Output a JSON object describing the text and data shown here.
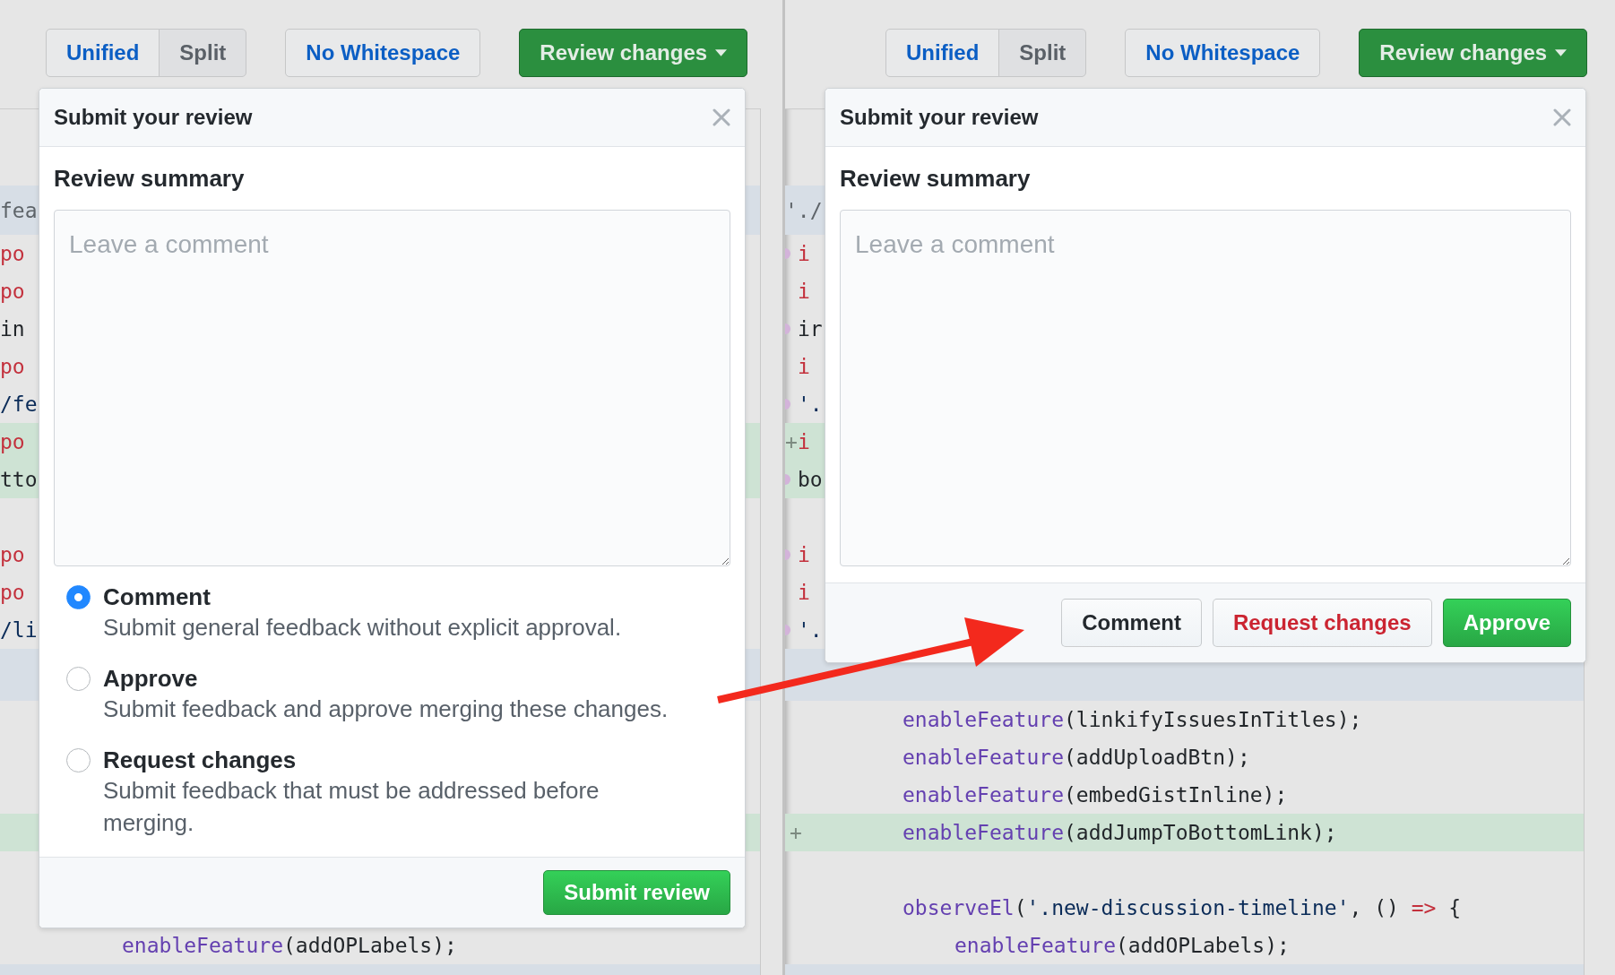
{
  "panels": [
    {
      "toolbar": {
        "view_tabs": [
          {
            "label": "Unified",
            "selected": false
          },
          {
            "label": "Split",
            "selected": true
          }
        ],
        "whitespace_button": "No Whitespace",
        "review_button": "Review changes"
      },
      "diff": {
        "upper_rows": [
          {
            "kind": "hunk",
            "tokens": [
              {
                "text": "fea",
                "kind": "comment"
              }
            ]
          },
          {
            "kind": "context",
            "tokens": [
              {
                "text": "po",
                "kind": "keyword"
              }
            ]
          },
          {
            "kind": "context",
            "tokens": [
              {
                "text": "po",
                "kind": "keyword"
              }
            ]
          },
          {
            "kind": "context",
            "tokens": [
              {
                "text": "in",
                "kind": "plain"
              }
            ]
          },
          {
            "kind": "context",
            "tokens": [
              {
                "text": "po",
                "kind": "keyword"
              }
            ]
          },
          {
            "kind": "context",
            "tokens": [
              {
                "text": "/fe",
                "kind": "string"
              }
            ]
          },
          {
            "kind": "added",
            "tokens": [
              {
                "text": "po",
                "kind": "keyword"
              }
            ]
          },
          {
            "kind": "added",
            "tokens": [
              {
                "text": "tto",
                "kind": "plain"
              }
            ]
          },
          {
            "kind": "context"
          },
          {
            "kind": "context",
            "tokens": [
              {
                "text": "po",
                "kind": "keyword"
              }
            ]
          },
          {
            "kind": "context",
            "tokens": [
              {
                "text": "po",
                "kind": "keyword"
              }
            ]
          },
          {
            "kind": "context",
            "tokens": [
              {
                "text": "/li",
                "kind": "string"
              }
            ]
          }
        ],
        "lower_rows": [
          {
            "kind": "hunk"
          },
          {
            "kind": "context"
          },
          {
            "kind": "context"
          },
          {
            "kind": "context"
          },
          {
            "kind": "added"
          },
          {
            "kind": "context"
          },
          {
            "kind": "context"
          },
          {
            "kind": "context",
            "indented": true,
            "tokens": [
              {
                "text": "enableFeature",
                "kind": "function"
              },
              {
                "text": "(addOPLabels);",
                "kind": "plain"
              }
            ]
          },
          {
            "kind": "hunk"
          }
        ]
      },
      "dialog": {
        "title": "Submit your review",
        "summary_label": "Review summary",
        "comment_field": {
          "placeholder": "Leave a comment"
        },
        "options": [
          {
            "label": "Comment",
            "description": "Submit general feedback without explicit approval.",
            "selected": true
          },
          {
            "label": "Approve",
            "description": "Submit feedback and approve merging these changes.",
            "selected": false
          },
          {
            "label": "Request changes",
            "description": "Submit feedback that must be addressed before merging.",
            "selected": false
          }
        ],
        "actions": [
          {
            "label": "Submit review",
            "kind": "primary"
          }
        ]
      }
    },
    {
      "toolbar": {
        "view_tabs": [
          {
            "label": "Unified",
            "selected": false
          },
          {
            "label": "Split",
            "selected": true
          }
        ],
        "whitespace_button": "No Whitespace",
        "review_button": "Review changes"
      },
      "diff": {
        "upper_rows": [
          {
            "kind": "hunk",
            "dot": false,
            "tokens": [
              {
                "text": "'./",
                "kind": "comment"
              }
            ]
          },
          {
            "kind": "context",
            "dot": true,
            "tokens": [
              {
                "text": "i",
                "kind": "keyword"
              }
            ]
          },
          {
            "kind": "context",
            "dot": false,
            "tokens": [
              {
                "text": "i",
                "kind": "keyword"
              }
            ]
          },
          {
            "kind": "context",
            "dot": true,
            "tokens": [
              {
                "text": "ir",
                "kind": "plain"
              }
            ]
          },
          {
            "kind": "context",
            "dot": false,
            "tokens": [
              {
                "text": "i",
                "kind": "keyword"
              }
            ]
          },
          {
            "kind": "context",
            "dot": true,
            "tokens": [
              {
                "text": "'.",
                "kind": "string"
              }
            ]
          },
          {
            "kind": "added",
            "dot": false,
            "marker": "+",
            "tokens": [
              {
                "text": "i",
                "kind": "keyword"
              }
            ]
          },
          {
            "kind": "added",
            "dot": true,
            "tokens": [
              {
                "text": "bo",
                "kind": "plain"
              }
            ]
          },
          {
            "kind": "context",
            "dot": false
          },
          {
            "kind": "context",
            "dot": true,
            "tokens": [
              {
                "text": "i",
                "kind": "keyword"
              }
            ]
          },
          {
            "kind": "context",
            "dot": false,
            "tokens": [
              {
                "text": "i",
                "kind": "keyword"
              }
            ]
          },
          {
            "kind": "context",
            "dot": true,
            "tokens": [
              {
                "text": "'.",
                "kind": "string"
              }
            ]
          }
        ],
        "lower_rows": [
          {
            "kind": "hunk"
          },
          {
            "kind": "context",
            "indented": false,
            "tokens": [
              {
                "text": "enableFeature",
                "kind": "function"
              },
              {
                "text": "(linkifyIssuesInTitles);",
                "kind": "plain"
              }
            ]
          },
          {
            "kind": "context",
            "indented": false,
            "tokens": [
              {
                "text": "enableFeature",
                "kind": "function"
              },
              {
                "text": "(addUploadBtn);",
                "kind": "plain"
              }
            ]
          },
          {
            "kind": "context",
            "indented": false,
            "tokens": [
              {
                "text": "enableFeature",
                "kind": "function"
              },
              {
                "text": "(embedGistInline);",
                "kind": "plain"
              }
            ]
          },
          {
            "kind": "added",
            "marker": "+",
            "indented": false,
            "tokens": [
              {
                "text": "enableFeature",
                "kind": "function"
              },
              {
                "text": "(addJumpToBottomLink);",
                "kind": "plain"
              }
            ]
          },
          {
            "kind": "context"
          },
          {
            "kind": "context",
            "indented": false,
            "tokens": [
              {
                "text": "observeEl",
                "kind": "function"
              },
              {
                "text": "(",
                "kind": "plain"
              },
              {
                "text": "'.new-discussion-timeline'",
                "kind": "string"
              },
              {
                "text": ", () ",
                "kind": "plain"
              },
              {
                "text": "=>",
                "kind": "keyword"
              },
              {
                "text": " {",
                "kind": "plain"
              }
            ]
          },
          {
            "kind": "context",
            "indented": true,
            "tokens": [
              {
                "text": "enableFeature",
                "kind": "function"
              },
              {
                "text": "(addOPLabels);",
                "kind": "plain"
              }
            ]
          },
          {
            "kind": "hunk"
          }
        ]
      },
      "dialog": {
        "title": "Submit your review",
        "summary_label": "Review summary",
        "comment_field": {
          "placeholder": "Leave a comment"
        },
        "actions": [
          {
            "label": "Comment",
            "kind": "default"
          },
          {
            "label": "Request changes",
            "kind": "danger"
          },
          {
            "label": "Approve",
            "kind": "primary"
          }
        ]
      }
    }
  ]
}
